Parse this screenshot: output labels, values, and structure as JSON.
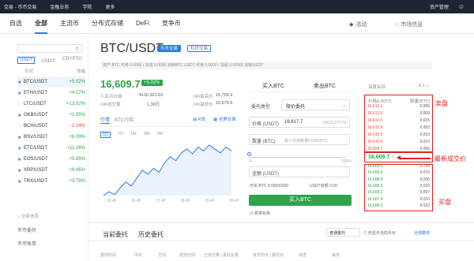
{
  "topbar": {
    "items": [
      "交易 - 币币交易",
      "金融业务",
      "学院",
      "更多"
    ],
    "right": [
      "资产管理"
    ]
  },
  "subnav": {
    "tabs": [
      "自选",
      "全部",
      "主流币",
      "分布式存储",
      "DeFi",
      "竞争币"
    ],
    "active": 1,
    "activity": "活动",
    "market_info": "市场信息"
  },
  "markets": {
    "tabs": [
      "USDT",
      "USD士",
      "CRYPTO"
    ],
    "headers": [
      "币对",
      "涨幅"
    ],
    "pairs": [
      {
        "name": "BTC/USDT",
        "change": "+5.02%",
        "dir": "up",
        "star": true
      },
      {
        "name": "ETH/USDT",
        "change": "+4.17%",
        "dir": "up",
        "star": true
      },
      {
        "name": "LTC/USDT",
        "change": "+13.52%",
        "dir": "up",
        "star": false
      },
      {
        "name": "OKB/USDT",
        "change": "+1.95%",
        "dir": "up",
        "star": true
      },
      {
        "name": "BCH/USDT",
        "change": "-1.24%",
        "dir": "dn",
        "star": false
      },
      {
        "name": "BSV/USDT",
        "change": "+6.09%",
        "dir": "up",
        "star": true
      },
      {
        "name": "ETC/USDT",
        "change": "+11.36%",
        "dir": "up",
        "star": true
      },
      {
        "name": "EOS/USDT",
        "change": "+5.65%",
        "dir": "up",
        "star": true
      },
      {
        "name": "XRP/USDT",
        "change": "+9.45%",
        "dir": "up",
        "star": true
      },
      {
        "name": "TRX/USDT",
        "change": "+3.79%",
        "dir": "up",
        "star": true
      }
    ],
    "footer_title": "交易信息",
    "footer_links": [
      "币币委托",
      "币币账单"
    ]
  },
  "pair": {
    "title": "BTC/USDT",
    "tag1": "币币交易",
    "tag2": "杠杆交易",
    "assets": "资产  BTC 可用 0.0000 / 冻结 0.0000  划转BTC  USDT 可用 0.0000 / 冻结 0.00000  划转USDT",
    "last_price": "16,609.7",
    "change": "+5.02%",
    "stats": {
      "cny_label": "人民币价格",
      "cny": "¥110,321.63",
      "high_label": "24h最高价",
      "high": "16,769.9",
      "vol_label": "24h成交量",
      "vol": "1.30万",
      "low_label": "24h最低价",
      "low": "15,679.6"
    }
  },
  "chart": {
    "tabs": [
      "行情",
      "BTC介绍"
    ],
    "right": [
      "K线",
      "全屏交易"
    ],
    "intervals": [
      "1D",
      "7D",
      "1M",
      "3M",
      "6M"
    ],
    "xlabels": [
      "15:45",
      "16:45",
      "17:45",
      "18:45",
      "19:45",
      "20:45"
    ]
  },
  "chart_data": {
    "type": "line",
    "values": [
      12,
      16,
      13,
      20,
      26,
      22,
      30,
      38,
      34,
      40,
      36,
      46,
      52,
      48,
      56,
      60,
      55,
      62,
      58,
      64,
      60,
      56,
      62,
      58
    ]
  },
  "trade": {
    "buy_tab": "买入BTC",
    "sell_tab": "卖出BTC",
    "order_type_label": "委托类型",
    "order_type": "限价委托",
    "price_label": "价格 (USDT)",
    "price": "16,617.7",
    "price_hint": "≈¥110,374.76",
    "amount_label": "数量 (BTC)",
    "amount_hint": "最小交易数量0.0001BTC",
    "slider_min": "0",
    "slider_max": "100%",
    "total_label": "金额 (USDT)",
    "avail": "可买 BTC 0.00000000",
    "usdt_bal": "USDT余额 0.00",
    "buy_button": "买入BTC",
    "checkbox": "费率标准"
  },
  "orderbook": {
    "depth_label": "深度合并",
    "depth_value": "0.1",
    "headers": [
      "价格(USDT)",
      "数量(BTC)"
    ],
    "asks": [
      {
        "p": "16,612.1",
        "q": "0.055"
      },
      {
        "p": "16,612.0",
        "q": "0.009"
      },
      {
        "p": "16,611.6",
        "q": "0.015"
      },
      {
        "p": "16,610.9",
        "q": "0.053"
      },
      {
        "p": "16,610.2",
        "q": "0.010"
      },
      {
        "p": "16,610.0",
        "q": "0.010"
      },
      {
        "p": "16,609.7",
        "q": "0.056"
      }
    ],
    "mid": "16,609.7 ↑",
    "bids": [
      {
        "p": "16,609.6",
        "q": "2.710"
      },
      {
        "p": "16,609.0",
        "q": "0.015"
      },
      {
        "p": "16,608.9",
        "q": "0.030"
      },
      {
        "p": "16,608.5",
        "q": "0.010"
      },
      {
        "p": "16,608.2",
        "q": "0.097"
      },
      {
        "p": "16,607.4",
        "q": "0.010"
      },
      {
        "p": "16,606.2",
        "q": "0.022"
      }
    ],
    "ask_annot": "卖盘",
    "bid_annot": "买盘",
    "mid_annot": "最新成交价"
  },
  "bottom": {
    "tabs": [
      "当前委托",
      "历史委托"
    ],
    "filter": "普通委托",
    "only_current": "仅显示当前币对",
    "cancel_all": "全部撤单",
    "headers": [
      "委托时间",
      "币对",
      "方向",
      "成交比例",
      "已成交量 | 委托总量",
      "成交均价 | 委托价",
      "状态",
      "操作"
    ]
  }
}
